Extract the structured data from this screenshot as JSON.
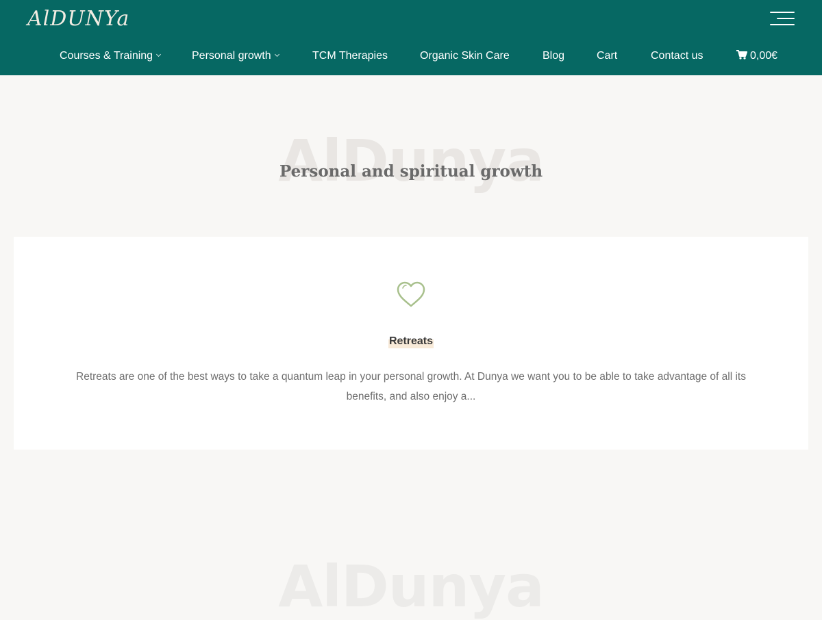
{
  "header": {
    "logo_text": "AlDUNYa",
    "nav": [
      {
        "label": "Courses & Training",
        "has_submenu": true
      },
      {
        "label": "Personal growth",
        "has_submenu": true
      },
      {
        "label": "TCM Therapies",
        "has_submenu": false
      },
      {
        "label": "Organic Skin Care",
        "has_submenu": false
      },
      {
        "label": "Blog",
        "has_submenu": false
      },
      {
        "label": "Cart",
        "has_submenu": false
      },
      {
        "label": "Contact us",
        "has_submenu": false
      }
    ],
    "cart_total": "0,00€",
    "menu_icon": "hamburger-icon"
  },
  "hero": {
    "watermark": "AlDunya",
    "title": "Personal and spiritual growth"
  },
  "card": {
    "icon": "heart-icon",
    "title": "Retreats",
    "text": "Retreats are one of the best ways to take a quantum leap in your personal growth. At Dunya we want you to be able to take advantage of all its benefits, and also enjoy a..."
  },
  "footer": {
    "watermark": "AlDunya"
  },
  "colors": {
    "header_bg": "#066863",
    "page_bg": "#f8f7f5",
    "accent": "#a8c08c",
    "highlight": "#f8ead8"
  }
}
